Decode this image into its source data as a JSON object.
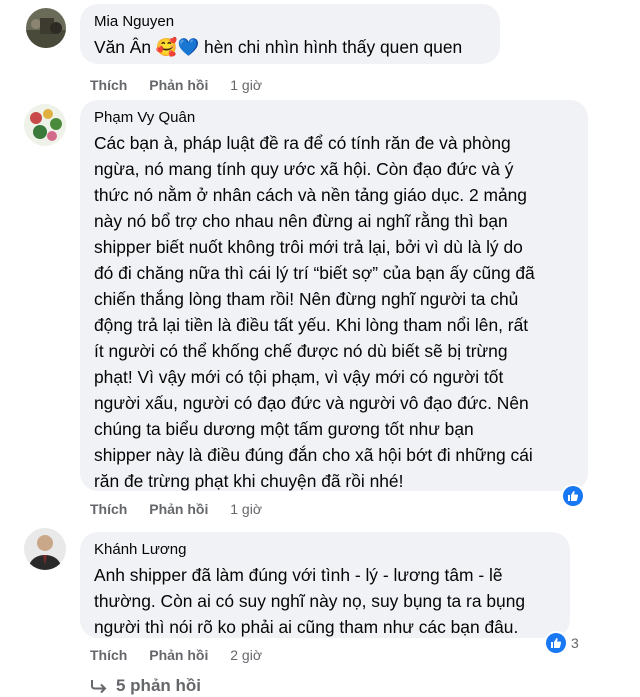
{
  "comments": [
    {
      "author": "Mia Nguyen",
      "text": "Văn Ân 🥰💙 hèn chi nhìn hình thấy quen quen",
      "actions": {
        "like": "Thích",
        "reply": "Phản hồi",
        "time": "1 giờ"
      }
    },
    {
      "author": "Phạm Vy Quân",
      "lines": [
        "Các bạn à, pháp luật đề ra để có tính răn đe và phòng",
        "ngừa, nó mang tính quy ước xã hội. Còn đạo đức và ý",
        "thức nó nằm ở nhân cách và nền tảng giáo dục. 2 mảng",
        "này nó bổ trợ cho nhau nên đừng ai nghĩ rằng thì bạn",
        "shipper biết nuốt không trôi mới trả lại, bởi vì dù là lý do",
        "đó đi chăng nữa thì cái lý trí “biết sợ” của bạn ấy cũng đã",
        "chiến thắng lòng tham rồi! Nên đừng nghĩ người ta chủ",
        "động trả lại tiền là điều tất yếu. Khi lòng tham nổi lên, rất",
        "ít người có thể khống chế được nó dù biết sẽ bị trừng",
        "phạt! Vì vậy mới có tội phạm, vì vậy mới có người tốt",
        "người xấu, người có đạo đức và người vô đạo đức. Nên",
        "chúng ta biểu dương một tấm gương tốt như bạn",
        "shipper này là điều đúng đắn cho xã hội bớt đi những cái",
        "răn đe trừng phạt khi chuyện đã rồi nhé!"
      ],
      "actions": {
        "like": "Thích",
        "reply": "Phản hồi",
        "time": "1 giờ"
      }
    },
    {
      "author": "Khánh Lương",
      "lines": [
        "Anh shipper đã làm đúng với tình - lý - lương tâm - lẽ",
        "thường. Còn ai có suy nghĩ này nọ, suy bụng ta ra bụng",
        "người thì nói rõ ko phải ai cũng tham như các bạn đâu."
      ],
      "reaction_count": "3",
      "actions": {
        "like": "Thích",
        "reply": "Phản hồi",
        "time": "2 giờ"
      }
    }
  ],
  "more_replies": "5 phản hồi",
  "colors": {
    "bubble": "#f0f2f5",
    "secondary_text": "#65676b",
    "like_blue": "#1877f2"
  },
  "icons": {
    "like": "thumbs-up-icon",
    "reply_arrow": "reply-arrow-icon"
  }
}
